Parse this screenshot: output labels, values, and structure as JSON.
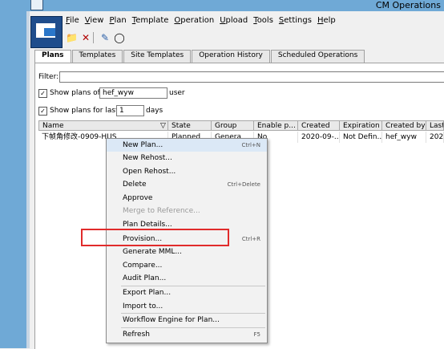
{
  "window": {
    "title": "CM Operations"
  },
  "menubar": [
    "File",
    "View",
    "Plan",
    "Template",
    "Operation",
    "Upload",
    "Tools",
    "Settings",
    "Help"
  ],
  "tabs": [
    "Plans",
    "Templates",
    "Site Templates",
    "Operation History",
    "Scheduled Operations"
  ],
  "filter": {
    "label": "Filter:",
    "value": ""
  },
  "show_plans_of": {
    "label": "Show plans of",
    "value": "hef_wyw",
    "suffix": "user",
    "checked": true
  },
  "show_plans_for_last": {
    "label": "Show plans for last",
    "value": "1",
    "suffix": "days",
    "checked": true
  },
  "table": {
    "columns": [
      "Name",
      "State",
      "Group",
      "Enable p...",
      "Created",
      "Expiration",
      "Created by",
      "Last"
    ],
    "rows": [
      [
        "下帧角修改-0909-HUS",
        "Planned",
        "Genera",
        "No",
        "2020-09-...",
        "Not Defin...",
        "hef_wyw",
        "202"
      ]
    ]
  },
  "context_menu": [
    {
      "label": "New Plan...",
      "shortcut": "Ctrl+N",
      "enabled": true
    },
    {
      "label": "New Rehost...",
      "shortcut": "",
      "enabled": true
    },
    {
      "label": "Open Rehost...",
      "shortcut": "",
      "enabled": true
    },
    {
      "label": "Delete",
      "shortcut": "Ctrl+Delete",
      "enabled": true
    },
    {
      "label": "Approve",
      "shortcut": "",
      "enabled": true
    },
    {
      "label": "Merge to Reference...",
      "shortcut": "",
      "enabled": false
    },
    {
      "label": "Plan Details...",
      "shortcut": "",
      "enabled": true
    },
    {
      "label": "Provision...",
      "shortcut": "Ctrl+R",
      "enabled": true
    },
    {
      "label": "Generate MML...",
      "shortcut": "",
      "enabled": true
    },
    {
      "label": "Compare...",
      "shortcut": "",
      "enabled": true
    },
    {
      "label": "Audit Plan...",
      "shortcut": "",
      "enabled": true
    },
    {
      "label": "Export Plan...",
      "shortcut": "",
      "enabled": true
    },
    {
      "label": "Import to...",
      "shortcut": "",
      "enabled": true
    },
    {
      "label": "Workflow Engine for Plan...",
      "shortcut": "",
      "enabled": true
    },
    {
      "label": "Refresh",
      "shortcut": "F5",
      "enabled": true
    }
  ],
  "colors": {
    "highlight_box": "#e12b2b",
    "title_bar": "#6fa9d6"
  }
}
